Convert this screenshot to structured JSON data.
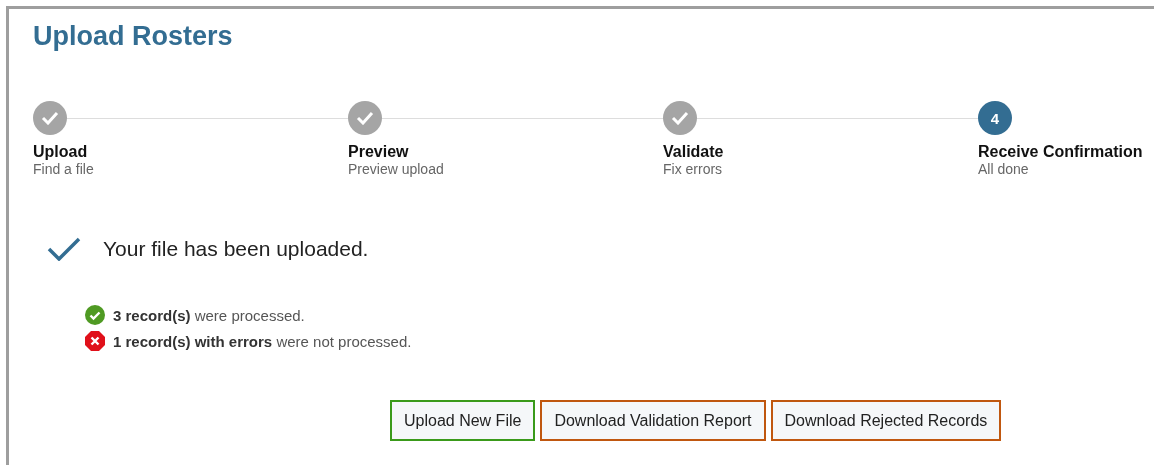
{
  "title": "Upload Rosters",
  "steps": [
    {
      "kind": "done",
      "label": "Upload",
      "sublabel": "Find a file"
    },
    {
      "kind": "done",
      "label": "Preview",
      "sublabel": "Preview upload"
    },
    {
      "kind": "done",
      "label": "Validate",
      "sublabel": "Fix errors"
    },
    {
      "kind": "current",
      "number": "4",
      "label": "Receive Confirmation",
      "sublabel": "All done"
    }
  ],
  "confirmation": "Your file has been uploaded.",
  "messages": [
    {
      "kind": "success",
      "text": "**3 record(s)** were processed."
    },
    {
      "kind": "error",
      "text": "**1 record(s) with errors** were not processed."
    }
  ],
  "buttons": [
    {
      "label": "Upload New File",
      "color": "#3a9a1a"
    },
    {
      "label": "Download Validation Report",
      "color": "#c0570f"
    },
    {
      "label": "Download Rejected Records",
      "color": "#c0570f"
    }
  ]
}
